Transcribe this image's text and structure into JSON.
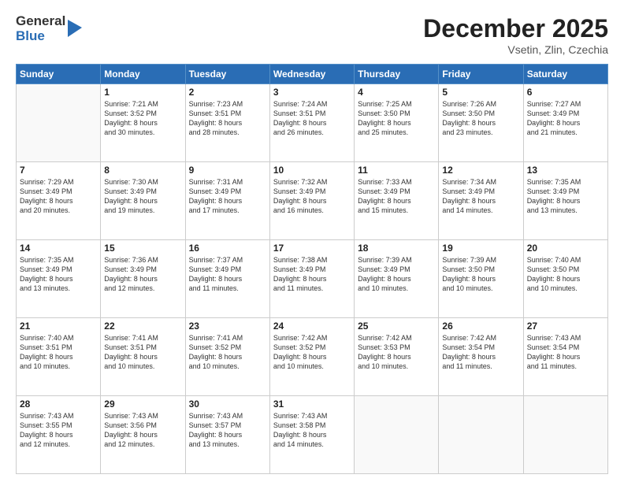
{
  "logo": {
    "general": "General",
    "blue": "Blue"
  },
  "header": {
    "month": "December 2025",
    "location": "Vsetin, Zlin, Czechia"
  },
  "days_of_week": [
    "Sunday",
    "Monday",
    "Tuesday",
    "Wednesday",
    "Thursday",
    "Friday",
    "Saturday"
  ],
  "weeks": [
    [
      {
        "day": "",
        "info": ""
      },
      {
        "day": "1",
        "info": "Sunrise: 7:21 AM\nSunset: 3:52 PM\nDaylight: 8 hours\nand 30 minutes."
      },
      {
        "day": "2",
        "info": "Sunrise: 7:23 AM\nSunset: 3:51 PM\nDaylight: 8 hours\nand 28 minutes."
      },
      {
        "day": "3",
        "info": "Sunrise: 7:24 AM\nSunset: 3:51 PM\nDaylight: 8 hours\nand 26 minutes."
      },
      {
        "day": "4",
        "info": "Sunrise: 7:25 AM\nSunset: 3:50 PM\nDaylight: 8 hours\nand 25 minutes."
      },
      {
        "day": "5",
        "info": "Sunrise: 7:26 AM\nSunset: 3:50 PM\nDaylight: 8 hours\nand 23 minutes."
      },
      {
        "day": "6",
        "info": "Sunrise: 7:27 AM\nSunset: 3:49 PM\nDaylight: 8 hours\nand 21 minutes."
      }
    ],
    [
      {
        "day": "7",
        "info": "Sunrise: 7:29 AM\nSunset: 3:49 PM\nDaylight: 8 hours\nand 20 minutes."
      },
      {
        "day": "8",
        "info": "Sunrise: 7:30 AM\nSunset: 3:49 PM\nDaylight: 8 hours\nand 19 minutes."
      },
      {
        "day": "9",
        "info": "Sunrise: 7:31 AM\nSunset: 3:49 PM\nDaylight: 8 hours\nand 17 minutes."
      },
      {
        "day": "10",
        "info": "Sunrise: 7:32 AM\nSunset: 3:49 PM\nDaylight: 8 hours\nand 16 minutes."
      },
      {
        "day": "11",
        "info": "Sunrise: 7:33 AM\nSunset: 3:49 PM\nDaylight: 8 hours\nand 15 minutes."
      },
      {
        "day": "12",
        "info": "Sunrise: 7:34 AM\nSunset: 3:49 PM\nDaylight: 8 hours\nand 14 minutes."
      },
      {
        "day": "13",
        "info": "Sunrise: 7:35 AM\nSunset: 3:49 PM\nDaylight: 8 hours\nand 13 minutes."
      }
    ],
    [
      {
        "day": "14",
        "info": "Sunrise: 7:35 AM\nSunset: 3:49 PM\nDaylight: 8 hours\nand 13 minutes."
      },
      {
        "day": "15",
        "info": "Sunrise: 7:36 AM\nSunset: 3:49 PM\nDaylight: 8 hours\nand 12 minutes."
      },
      {
        "day": "16",
        "info": "Sunrise: 7:37 AM\nSunset: 3:49 PM\nDaylight: 8 hours\nand 11 minutes."
      },
      {
        "day": "17",
        "info": "Sunrise: 7:38 AM\nSunset: 3:49 PM\nDaylight: 8 hours\nand 11 minutes."
      },
      {
        "day": "18",
        "info": "Sunrise: 7:39 AM\nSunset: 3:49 PM\nDaylight: 8 hours\nand 10 minutes."
      },
      {
        "day": "19",
        "info": "Sunrise: 7:39 AM\nSunset: 3:50 PM\nDaylight: 8 hours\nand 10 minutes."
      },
      {
        "day": "20",
        "info": "Sunrise: 7:40 AM\nSunset: 3:50 PM\nDaylight: 8 hours\nand 10 minutes."
      }
    ],
    [
      {
        "day": "21",
        "info": "Sunrise: 7:40 AM\nSunset: 3:51 PM\nDaylight: 8 hours\nand 10 minutes."
      },
      {
        "day": "22",
        "info": "Sunrise: 7:41 AM\nSunset: 3:51 PM\nDaylight: 8 hours\nand 10 minutes."
      },
      {
        "day": "23",
        "info": "Sunrise: 7:41 AM\nSunset: 3:52 PM\nDaylight: 8 hours\nand 10 minutes."
      },
      {
        "day": "24",
        "info": "Sunrise: 7:42 AM\nSunset: 3:52 PM\nDaylight: 8 hours\nand 10 minutes."
      },
      {
        "day": "25",
        "info": "Sunrise: 7:42 AM\nSunset: 3:53 PM\nDaylight: 8 hours\nand 10 minutes."
      },
      {
        "day": "26",
        "info": "Sunrise: 7:42 AM\nSunset: 3:54 PM\nDaylight: 8 hours\nand 11 minutes."
      },
      {
        "day": "27",
        "info": "Sunrise: 7:43 AM\nSunset: 3:54 PM\nDaylight: 8 hours\nand 11 minutes."
      }
    ],
    [
      {
        "day": "28",
        "info": "Sunrise: 7:43 AM\nSunset: 3:55 PM\nDaylight: 8 hours\nand 12 minutes."
      },
      {
        "day": "29",
        "info": "Sunrise: 7:43 AM\nSunset: 3:56 PM\nDaylight: 8 hours\nand 12 minutes."
      },
      {
        "day": "30",
        "info": "Sunrise: 7:43 AM\nSunset: 3:57 PM\nDaylight: 8 hours\nand 13 minutes."
      },
      {
        "day": "31",
        "info": "Sunrise: 7:43 AM\nSunset: 3:58 PM\nDaylight: 8 hours\nand 14 minutes."
      },
      {
        "day": "",
        "info": ""
      },
      {
        "day": "",
        "info": ""
      },
      {
        "day": "",
        "info": ""
      }
    ]
  ]
}
